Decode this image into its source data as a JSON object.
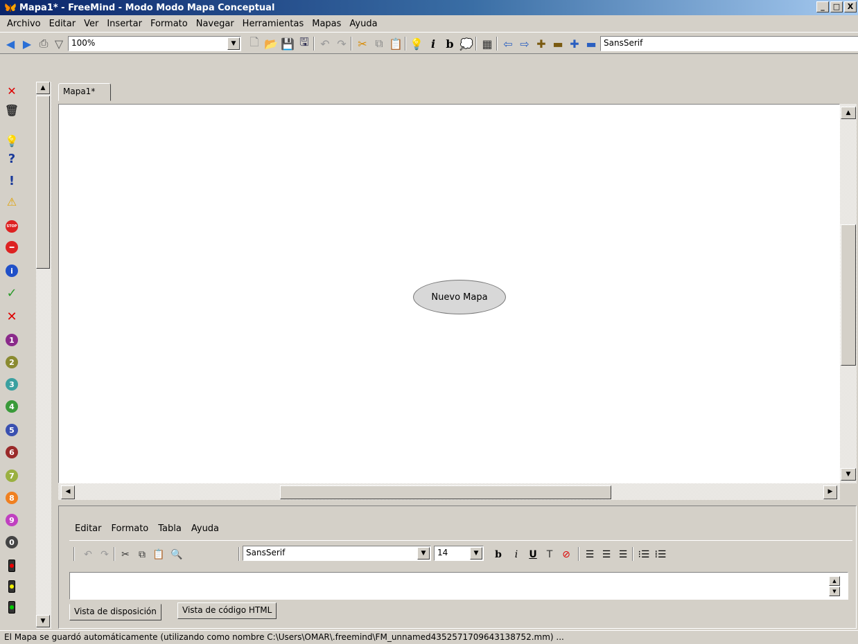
{
  "window": {
    "title": "Mapa1* - FreeMind - Modo Modo Mapa Conceptual",
    "min": "_",
    "max": "□",
    "close": "X"
  },
  "menu": [
    "Archivo",
    "Editar",
    "Ver",
    "Insertar",
    "Formato",
    "Navegar",
    "Herramientas",
    "Mapas",
    "Ayuda"
  ],
  "toolbar": {
    "zoom": "100%",
    "font": "SansSerif"
  },
  "tab": {
    "label": "Mapa1*"
  },
  "map": {
    "root_node": "Nuevo Mapa"
  },
  "editor": {
    "menu": [
      "Editar",
      "Formato",
      "Tabla",
      "Ayuda"
    ],
    "font": "SansSerif",
    "size": "14",
    "bold": "b",
    "italic": "i",
    "underline": "U",
    "tabs": [
      "Vista de disposición",
      "Vista de código HTML"
    ]
  },
  "icons": {
    "nums": [
      "1",
      "2",
      "3",
      "4",
      "5",
      "6",
      "7",
      "8",
      "9",
      "0"
    ],
    "question": "?",
    "exclaim": "!",
    "stop": "STOP",
    "info": "i",
    "check": "✓",
    "cross": "✕"
  },
  "status": "El Mapa se guardó automáticamente (utilizando como nombre C:\\Users\\OMAR\\.freemind\\FM_unnamed4352571709643138752.mm) ...",
  "colors": {
    "title_start": "#0a246a",
    "title_end": "#a6caf0",
    "node_fill": "#d8d8d8"
  }
}
